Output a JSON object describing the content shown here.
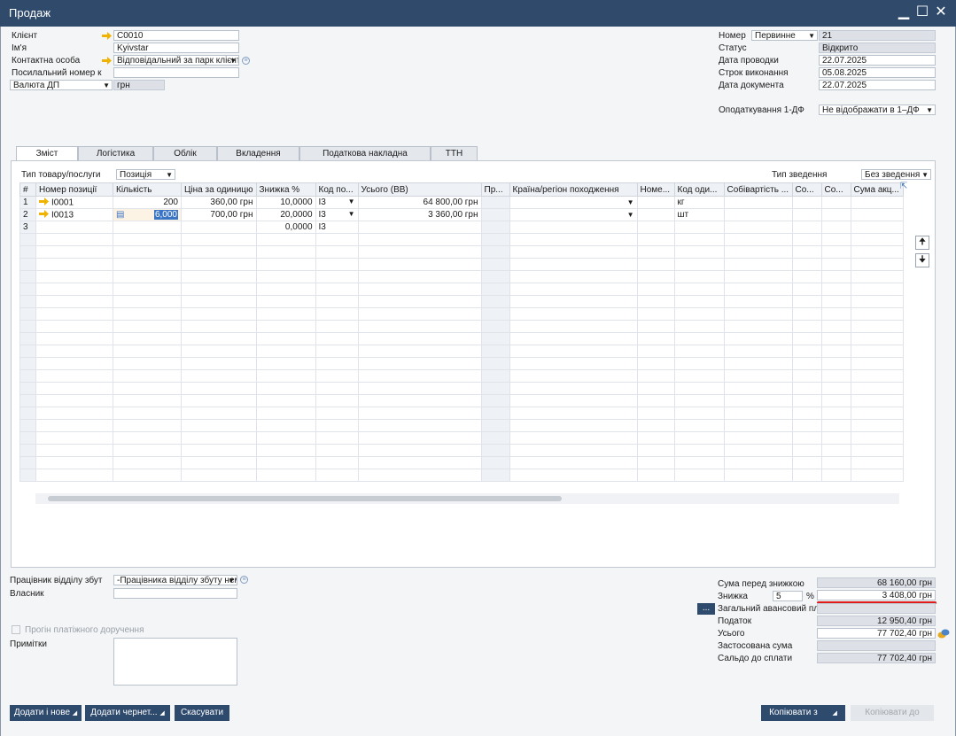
{
  "window": {
    "title": "Продаж"
  },
  "header_left": {
    "client_label": "Клієнт",
    "client_value": "C0010",
    "name_label": "Ім'я",
    "name_value": "Kyivstar",
    "contact_label": "Контактна особа",
    "contact_value": "Відповідальний за парк клієнт",
    "refnum_label": "Посилальний номер к",
    "refnum_value": "",
    "currency_label": "Валюта ДП",
    "currency_value": "грн"
  },
  "header_right": {
    "number_label": "Номер",
    "number_series": "Первинне",
    "number_value": "21",
    "status_label": "Статус",
    "status_value": "Відкрито",
    "posting_label": "Дата проводки",
    "posting_value": "22.07.2025",
    "due_label": "Строк виконання",
    "due_value": "05.08.2025",
    "docdate_label": "Дата документа",
    "docdate_value": "22.07.2025",
    "tax_label": "Оподаткування 1-ДФ",
    "tax_value": "Не відображати в 1–ДФ"
  },
  "tabs": [
    "Зміст",
    "Логістика",
    "Облік",
    "Вкладення",
    "Податкова накладна",
    "ТТН"
  ],
  "contents": {
    "item_type_label": "Тип товару/послуги",
    "item_type_value": "Позиція",
    "summary_label": "Тип зведення",
    "summary_value": "Без зведення",
    "columns": [
      "#",
      "Номер позиції",
      "Кількість",
      "Ціна за одиницю",
      "Знижка %",
      "Код по...",
      "Усього (ВВ)",
      "Пр...",
      "Країна/регіон походження",
      "Номе...",
      "Код оди...",
      "Собівартість ...",
      "Со...",
      "Со...",
      "Сума акц..."
    ],
    "rows": [
      {
        "n": "1",
        "item": "I0001",
        "qty": "200",
        "price": "360,00 грн",
        "disc": "10,0000",
        "tax": "I3",
        "total": "64 800,00 грн",
        "unit": "кг"
      },
      {
        "n": "2",
        "item": "I0013",
        "qty": "6,000",
        "price": "700,00 грн",
        "disc": "20,0000",
        "tax": "I3",
        "total": "3 360,00 грн",
        "unit": "шт"
      },
      {
        "n": "3",
        "item": "",
        "qty": "",
        "price": "",
        "disc": "0,0000",
        "tax": "I3",
        "total": "",
        "unit": ""
      }
    ]
  },
  "footer_left": {
    "sales_emp_label": "Працівник відділу збут",
    "sales_emp_value": "-Працівника відділу збуту нем",
    "owner_label": "Власник",
    "owner_value": "",
    "payment_run_label": "Прогін платіжного доручення",
    "remarks_label": "Примітки",
    "remarks_value": ""
  },
  "footer_right": {
    "before_disc_label": "Сума перед знижкою",
    "before_disc_value": "68 160,00 грн",
    "disc_label": "Знижка",
    "disc_pct": "5",
    "pct_sign": "%",
    "disc_value": "3 408,00 грн",
    "dots": "...",
    "advance_label": "Загальний авансовий пл",
    "advance_value": "",
    "tax_label": "Податок",
    "tax_value": "12 950,40 грн",
    "total_label": "Усього",
    "total_value": "77 702,40 грн",
    "applied_label": "Застосована сума",
    "applied_value": "",
    "balance_label": "Сальдо до сплати",
    "balance_value": "77 702,40 грн"
  },
  "buttons": {
    "add_new": "Додати і нове",
    "add_draft": "Додати чернет...",
    "cancel": "Скасувати",
    "copy_from": "Копіювати з",
    "copy_to": "Копіювати до"
  },
  "colors": {
    "titlebar": "#2f4a6b",
    "button": "#2e4a6d",
    "highlight_line": "#e01b1b",
    "link_arrow": "#f0b400"
  }
}
